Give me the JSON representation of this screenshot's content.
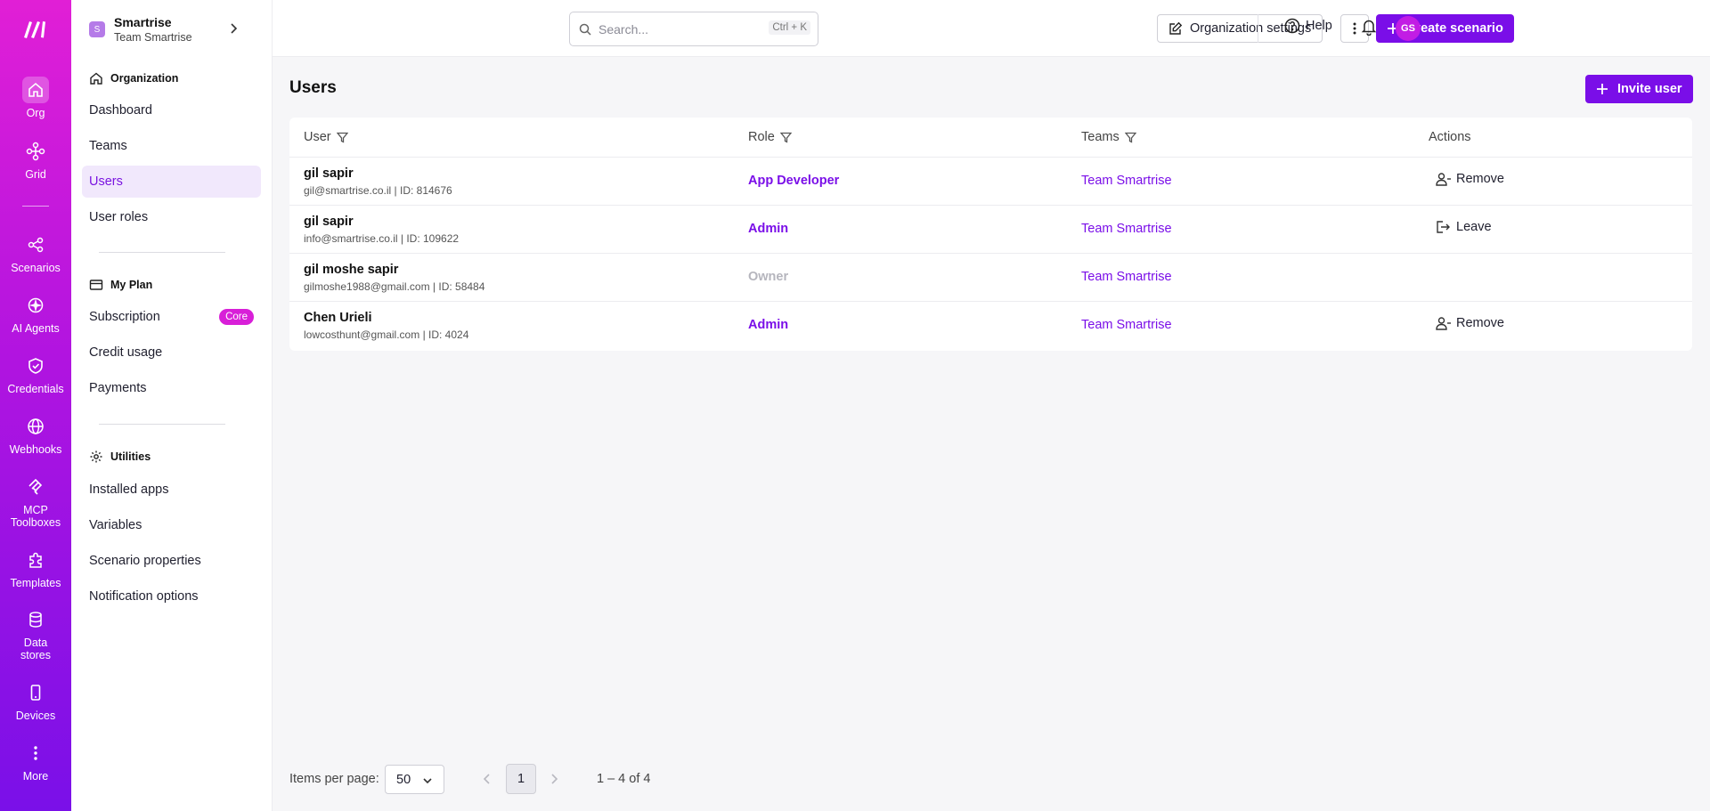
{
  "rail": {
    "items": [
      {
        "label": "Org",
        "icon": "home-icon"
      },
      {
        "label": "Grid",
        "icon": "grid-icon"
      },
      {
        "label": "Scenarios",
        "icon": "scenarios-icon"
      },
      {
        "label": "AI Agents",
        "icon": "ai-agents-icon"
      },
      {
        "label": "Credentials",
        "icon": "shield-icon"
      },
      {
        "label": "Webhooks",
        "icon": "globe-icon"
      },
      {
        "label": "MCP Toolboxes",
        "icon": "mcp-icon"
      },
      {
        "label": "Templates",
        "icon": "puzzle-icon"
      },
      {
        "label": "Data stores",
        "icon": "database-icon"
      },
      {
        "label": "Devices",
        "icon": "phone-icon"
      },
      {
        "label": "More",
        "icon": "more-icon"
      }
    ],
    "mcp_line1": "MCP",
    "mcp_line2": "Toolboxes",
    "data_line1": "Data",
    "data_line2": "stores"
  },
  "org": {
    "badge": "S",
    "name": "Smartrise",
    "team": "Team Smartrise"
  },
  "sidebar": {
    "organization": {
      "heading": "Organization",
      "items": [
        "Dashboard",
        "Teams",
        "Users",
        "User roles"
      ]
    },
    "plan": {
      "heading": "My Plan",
      "items": [
        "Subscription",
        "Credit usage",
        "Payments"
      ],
      "subscription_badge": "Core"
    },
    "utilities": {
      "heading": "Utilities",
      "items": [
        "Installed apps",
        "Variables",
        "Scenario properties",
        "Notification options"
      ]
    }
  },
  "topbar": {
    "search_placeholder": "Search...",
    "search_shortcut": "Ctrl + K",
    "org_settings": "Organization settings",
    "create_scenario": "Create scenario",
    "help": "Help",
    "avatar": "GS"
  },
  "main": {
    "title": "Users",
    "invite": "Invite user",
    "columns": {
      "user": "User",
      "role": "Role",
      "teams": "Teams",
      "actions": "Actions"
    },
    "rows": [
      {
        "name": "gil sapir",
        "meta": "gil@smartrise.co.il | ID: 814676",
        "role": "App Developer",
        "team": "Team Smartrise",
        "action": "Remove"
      },
      {
        "name": "gil sapir",
        "meta": "info@smartrise.co.il | ID: 109622",
        "role": "Admin",
        "team": "Team Smartrise",
        "action": "Leave"
      },
      {
        "name": "gil moshe sapir",
        "meta": "gilmoshe1988@gmail.com | ID: 58484",
        "role": "Owner",
        "team": "Team Smartrise",
        "action": ""
      },
      {
        "name": "Chen Urieli",
        "meta": "lowcosthunt@gmail.com | ID: 4024",
        "role": "Admin",
        "team": "Team Smartrise",
        "action": "Remove"
      }
    ]
  },
  "pagination": {
    "label": "Items per page:",
    "per_page": "50",
    "page": "1",
    "range": "1 – 4 of 4"
  },
  "colors": {
    "accent": "#7a0ee8",
    "rail_top": "#e11fd6",
    "rail_bottom": "#7a10e8",
    "badge": "#d81fd8"
  }
}
